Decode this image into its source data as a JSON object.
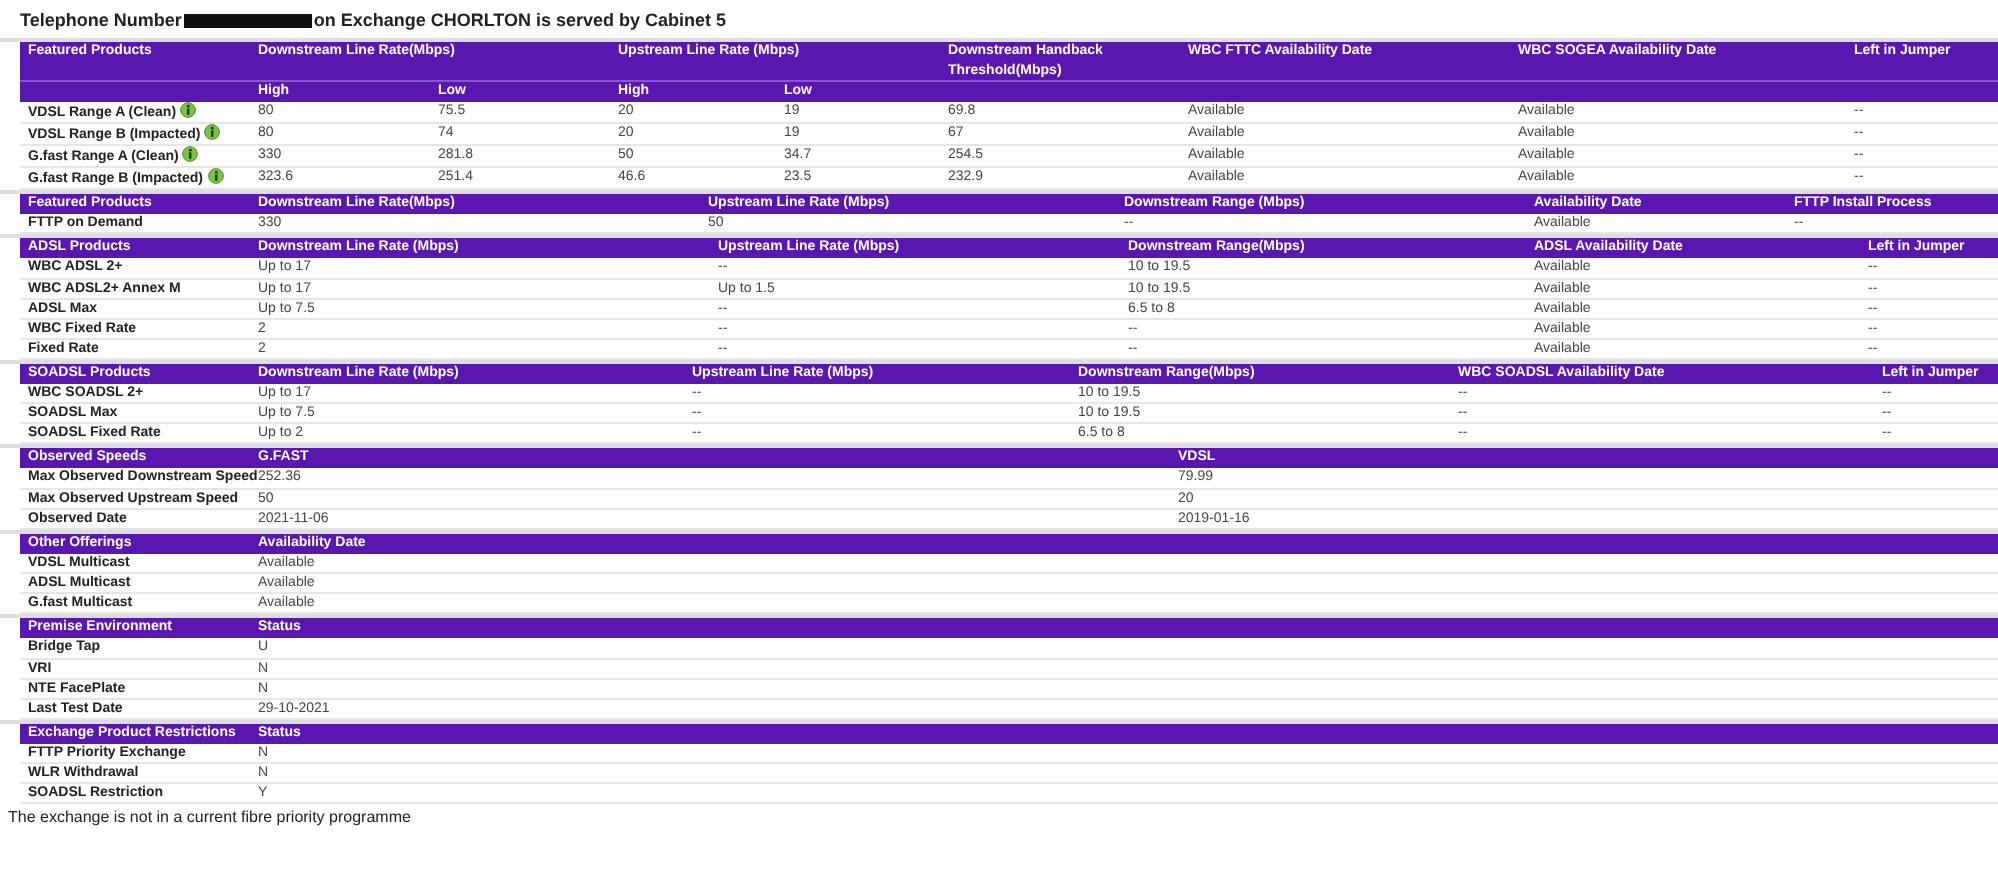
{
  "title": {
    "before": "Telephone Number",
    "after": "on Exchange CHORLTON is served by Cabinet 5",
    "number_redacted": true
  },
  "sections": [
    {
      "columns": [
        {
          "label": "Featured Products"
        },
        {
          "label": "Downstream Line Rate(Mbps)",
          "colspan": 2,
          "sub": [
            "High",
            "Low"
          ]
        },
        {
          "label": "Upstream Line Rate (Mbps)",
          "colspan": 2,
          "sub": [
            "High",
            "Low"
          ]
        },
        {
          "label": "Downstream Handback Threshold(Mbps)"
        },
        {
          "label": "WBC FTTC Availability Date"
        },
        {
          "label": "WBC SOGEA Availability Date"
        },
        {
          "label": "Left in Jumper"
        }
      ],
      "rows": [
        {
          "info": true,
          "cells": [
            "VDSL Range A (Clean)",
            "80",
            "75.5",
            "20",
            "19",
            "69.8",
            "Available",
            "Available",
            "--"
          ]
        },
        {
          "info": true,
          "cells": [
            "VDSL Range B (Impacted)",
            "80",
            "74",
            "20",
            "19",
            "67",
            "Available",
            "Available",
            "--"
          ]
        },
        {
          "info": true,
          "cells": [
            "G.fast Range A (Clean)",
            "330",
            "281.8",
            "50",
            "34.7",
            "254.5",
            "Available",
            "Available",
            "--"
          ]
        },
        {
          "info": true,
          "cells": [
            "G.fast Range B (Impacted)",
            "323.6",
            "251.4",
            "46.6",
            "23.5",
            "232.9",
            "Available",
            "Available",
            "--"
          ]
        }
      ]
    },
    {
      "columns": [
        {
          "label": "Featured Products"
        },
        {
          "label": "Downstream Line Rate(Mbps)"
        },
        {
          "label": "Upstream Line Rate (Mbps)"
        },
        {
          "label": "Downstream Range (Mbps)"
        },
        {
          "label": "Availability Date"
        },
        {
          "label": "FTTP Install Process"
        }
      ],
      "rows": [
        {
          "cells": [
            "FTTP on Demand",
            "330",
            "50",
            "--",
            "Available",
            "--"
          ]
        }
      ]
    },
    {
      "columns": [
        {
          "label": "ADSL Products"
        },
        {
          "label": "Downstream Line Rate (Mbps)"
        },
        {
          "label": "Upstream Line Rate (Mbps)"
        },
        {
          "label": "Downstream Range(Mbps)"
        },
        {
          "label": "ADSL Availability Date"
        },
        {
          "label": "Left in Jumper"
        }
      ],
      "rows": [
        {
          "cells": [
            "WBC ADSL 2+",
            "Up to 17",
            "--",
            "10 to 19.5",
            "Available",
            "--"
          ]
        },
        {
          "cells": [
            "WBC ADSL2+ Annex M",
            "Up to 17",
            "Up to 1.5",
            "10 to 19.5",
            "Available",
            "--"
          ]
        },
        {
          "cells": [
            "ADSL Max",
            "Up to 7.5",
            "--",
            "6.5 to 8",
            "Available",
            "--"
          ]
        },
        {
          "cells": [
            "WBC Fixed Rate",
            "2",
            "--",
            "--",
            "Available",
            "--"
          ]
        },
        {
          "cells": [
            "Fixed Rate",
            "2",
            "--",
            "--",
            "Available",
            "--"
          ]
        }
      ]
    },
    {
      "columns": [
        {
          "label": "SOADSL Products"
        },
        {
          "label": "Downstream Line Rate (Mbps)"
        },
        {
          "label": "Upstream Line Rate (Mbps)"
        },
        {
          "label": "Downstream Range(Mbps)"
        },
        {
          "label": "WBC SOADSL Availability Date"
        },
        {
          "label": "Left in Jumper"
        }
      ],
      "rows": [
        {
          "cells": [
            "WBC SOADSL 2+",
            "Up to 17",
            "--",
            "10 to 19.5",
            "--",
            "--"
          ]
        },
        {
          "cells": [
            "SOADSL Max",
            "Up to 7.5",
            "--",
            "10 to 19.5",
            "--",
            "--"
          ]
        },
        {
          "cells": [
            "SOADSL Fixed Rate",
            "Up to 2",
            "--",
            "6.5 to 8",
            "--",
            "--"
          ]
        }
      ]
    },
    {
      "columns": [
        {
          "label": "Observed Speeds"
        },
        {
          "label": "G.FAST"
        },
        {
          "label": "VDSL"
        }
      ],
      "rows": [
        {
          "cells": [
            "Max Observed Downstream Speed",
            "252.36",
            "79.99"
          ]
        },
        {
          "cells": [
            "Max Observed Upstream Speed",
            "50",
            "20"
          ]
        },
        {
          "cells": [
            "Observed Date",
            "2021-11-06",
            "2019-01-16"
          ]
        }
      ]
    },
    {
      "columns": [
        {
          "label": "Other Offerings"
        },
        {
          "label": "Availability Date"
        }
      ],
      "rows": [
        {
          "cells": [
            "VDSL Multicast",
            "Available"
          ]
        },
        {
          "cells": [
            "ADSL Multicast",
            "Available"
          ]
        },
        {
          "cells": [
            "G.fast Multicast",
            "Available"
          ]
        }
      ]
    },
    {
      "columns": [
        {
          "label": "Premise Environment"
        },
        {
          "label": "Status"
        }
      ],
      "rows": [
        {
          "cells": [
            "Bridge Tap",
            "U"
          ]
        },
        {
          "cells": [
            "VRI",
            "N"
          ]
        },
        {
          "cells": [
            "NTE FacePlate",
            "N"
          ]
        },
        {
          "cells": [
            "Last Test Date",
            "29-10-2021"
          ]
        }
      ]
    },
    {
      "columns": [
        {
          "label": "Exchange Product Restrictions"
        },
        {
          "label": "Status"
        }
      ],
      "rows": [
        {
          "cells": [
            "FTTP Priority Exchange",
            "N"
          ]
        },
        {
          "cells": [
            "WLR Withdrawal",
            "N"
          ]
        },
        {
          "cells": [
            "SOADSL Restriction",
            "Y"
          ]
        }
      ]
    }
  ],
  "footer": "The exchange is not in a current fibre priority programme"
}
